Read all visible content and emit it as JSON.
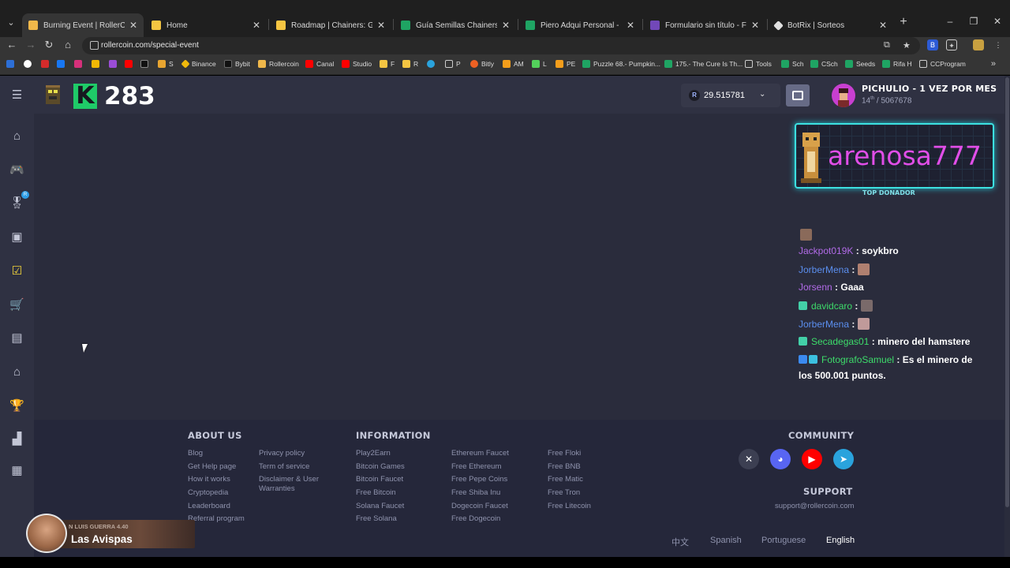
{
  "browser": {
    "tabs": [
      {
        "label": "Burning Event | RollerCoin",
        "active": true,
        "color": "#f0b84a"
      },
      {
        "label": "Home",
        "active": false,
        "color": "#f5c542"
      },
      {
        "label": "Roadmap | Chainers: GitBook",
        "active": false,
        "color": "#f5c542"
      },
      {
        "label": "Guía Semillas Chainers by Piero",
        "active": false,
        "color": "#1fa463"
      },
      {
        "label": "Piero Adqui Personal - Hojas de",
        "active": false,
        "color": "#1fa463"
      },
      {
        "label": "Formulario sin título - Formular",
        "active": false,
        "color": "#7248b9"
      },
      {
        "label": "BotRix | Sorteos",
        "active": false,
        "color": "#e0e0e0"
      }
    ],
    "close_glyph": "✕",
    "new_tab_glyph": "+",
    "url": "rollercoin.com/special-event",
    "bookmarks": [
      "Binance",
      "Bybit",
      "Rollercoin",
      "Canal",
      "Studio",
      "F",
      "R",
      "P",
      "Bitly",
      "AM",
      "L",
      "PE",
      "Puzzle 68.- Pumpkin...",
      "175.- The Cure Is Th...",
      "Tools",
      "Sch",
      "CSch",
      "Seeds",
      "Rifa H",
      "CCProgram"
    ],
    "bookmark_single": [
      "S"
    ]
  },
  "header": {
    "k_letter": "K",
    "k_count": "283",
    "balance_currency": "R",
    "balance_value": "29.515781",
    "user_name": "PICHULIO - 1 VEZ POR MES",
    "user_rank_pos": "14",
    "user_rank_suffix": "th",
    "user_rank_total": " / 5067678"
  },
  "donor": {
    "name": "arenosa777",
    "label": "TOP DONADOR"
  },
  "chat": [
    {
      "user": "Jackpot019K",
      "msg": "soykbro",
      "color": "purple"
    },
    {
      "user": "JorberMena",
      "msg": "",
      "color": "blue"
    },
    {
      "user": "Jorsenn",
      "msg": "Gaaa",
      "color": "purple"
    },
    {
      "user": "davidcaro",
      "msg": "",
      "color": "green"
    },
    {
      "user": "JorberMena",
      "msg": "",
      "color": "blue"
    },
    {
      "user": "Secadegas01",
      "msg": "minero del hamstere",
      "color": "green"
    },
    {
      "user": "FotografoSamuel",
      "msg": "Es el minero de",
      "color": "green"
    },
    {
      "msg_cont": "los 500.001 puntos."
    }
  ],
  "chat_separator": " : ",
  "footer": {
    "about_us": {
      "title": "ABOUT US",
      "col1": [
        "Blog",
        "Get Help page",
        "How it works",
        "Cryptopedia",
        "Leaderboard",
        "Referral program"
      ],
      "col2": [
        "Privacy policy",
        "Term of service",
        "Disclaimer & User",
        "Warranties"
      ]
    },
    "information": {
      "title": "INFORMATION",
      "col1": [
        "Play2Earn",
        "Bitcoin Games",
        "Bitcoin Faucet",
        "Free Bitcoin",
        "Solana Faucet",
        "Free Solana"
      ],
      "col2": [
        "Ethereum Faucet",
        "Free Ethereum",
        "Free Pepe Coins",
        "Free Shiba Inu",
        "Dogecoin Faucet",
        "Free Dogecoin"
      ],
      "col3": [
        "Free Floki",
        "Free BNB",
        "Free Matic",
        "Free Tron",
        "Free Litecoin"
      ]
    },
    "community_title": "COMMUNITY",
    "support_title": "SUPPORT",
    "support_email": "support@rollercoin.com",
    "languages": [
      "中文",
      "Spanish",
      "Portuguese",
      "English"
    ],
    "active_language": "English"
  },
  "overlay": {
    "small_text": "N LUIS GUERRA 4.40",
    "title": "Las Avispas"
  },
  "colors": {
    "page_bg": "#2a2c3c",
    "sidebar_bg": "#2f3142",
    "accent_green": "#1fcb68",
    "donor_border": "#3ce0e0",
    "donor_name": "#e14ee8"
  }
}
